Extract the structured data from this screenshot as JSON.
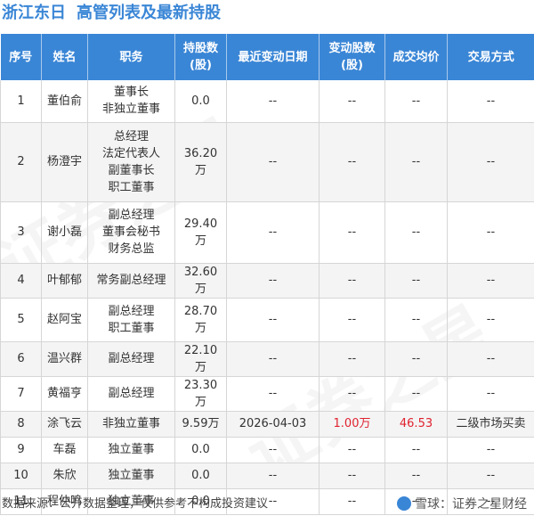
{
  "header": {
    "company": "浙江东日",
    "title": "高管列表及最新持股"
  },
  "table": {
    "columns": [
      "序号",
      "姓名",
      "职务",
      "持股数|(股)",
      "最近变动日期",
      "变动股数|(股)",
      "成交均价",
      "交易方式"
    ],
    "rows": [
      {
        "no": "1",
        "name": "董伯俞",
        "position": [
          "董事长",
          "非独立董事"
        ],
        "shares": "0.0",
        "date": "--",
        "change": "--",
        "price": "--",
        "mode": "--"
      },
      {
        "no": "2",
        "name": "杨澄宇",
        "position": [
          "总经理",
          "法定代表人",
          "副董事长",
          "职工董事"
        ],
        "shares": "36.20万",
        "date": "--",
        "change": "--",
        "price": "--",
        "mode": "--"
      },
      {
        "no": "3",
        "name": "谢小磊",
        "position": [
          "副总经理",
          "董事会秘书",
          "财务总监"
        ],
        "shares": "29.40万",
        "date": "--",
        "change": "--",
        "price": "--",
        "mode": "--"
      },
      {
        "no": "4",
        "name": "叶郁郁",
        "position": [
          "常务副总经理"
        ],
        "shares": "32.60万",
        "date": "--",
        "change": "--",
        "price": "--",
        "mode": "--"
      },
      {
        "no": "5",
        "name": "赵阿宝",
        "position": [
          "副总经理",
          "职工董事"
        ],
        "shares": "28.70万",
        "date": "--",
        "change": "--",
        "price": "--",
        "mode": "--"
      },
      {
        "no": "6",
        "name": "温兴群",
        "position": [
          "副总经理"
        ],
        "shares": "22.10万",
        "date": "--",
        "change": "--",
        "price": "--",
        "mode": "--"
      },
      {
        "no": "7",
        "name": "黄福亨",
        "position": [
          "副总经理"
        ],
        "shares": "23.30万",
        "date": "--",
        "change": "--",
        "price": "--",
        "mode": "--"
      },
      {
        "no": "8",
        "name": "涂飞云",
        "position": [
          "非独立董事"
        ],
        "shares": "9.59万",
        "date": "2026-04-03",
        "change": "1.00万",
        "price": "46.53",
        "mode": "二级市场买卖"
      },
      {
        "no": "9",
        "name": "车磊",
        "position": [
          "独立董事"
        ],
        "shares": "0.0",
        "date": "--",
        "change": "--",
        "price": "--",
        "mode": "--"
      },
      {
        "no": "10",
        "name": "朱欣",
        "position": [
          "独立董事"
        ],
        "shares": "0.0",
        "date": "--",
        "change": "--",
        "price": "--",
        "mode": "--"
      },
      {
        "no": "11",
        "name": "程仲鸣",
        "position": [
          "独立董事"
        ],
        "shares": "0.0",
        "date": "--",
        "change": "--",
        "price": "--",
        "mode": "--"
      }
    ]
  },
  "footer": {
    "source": "数据来源：公开数据整理，仅供参考不构成投资建议",
    "brand": "雪球：证券之星财经"
  },
  "watermark": "证券之星",
  "colors": {
    "accent": "#3a86d6",
    "highlight": "#e0222f"
  }
}
